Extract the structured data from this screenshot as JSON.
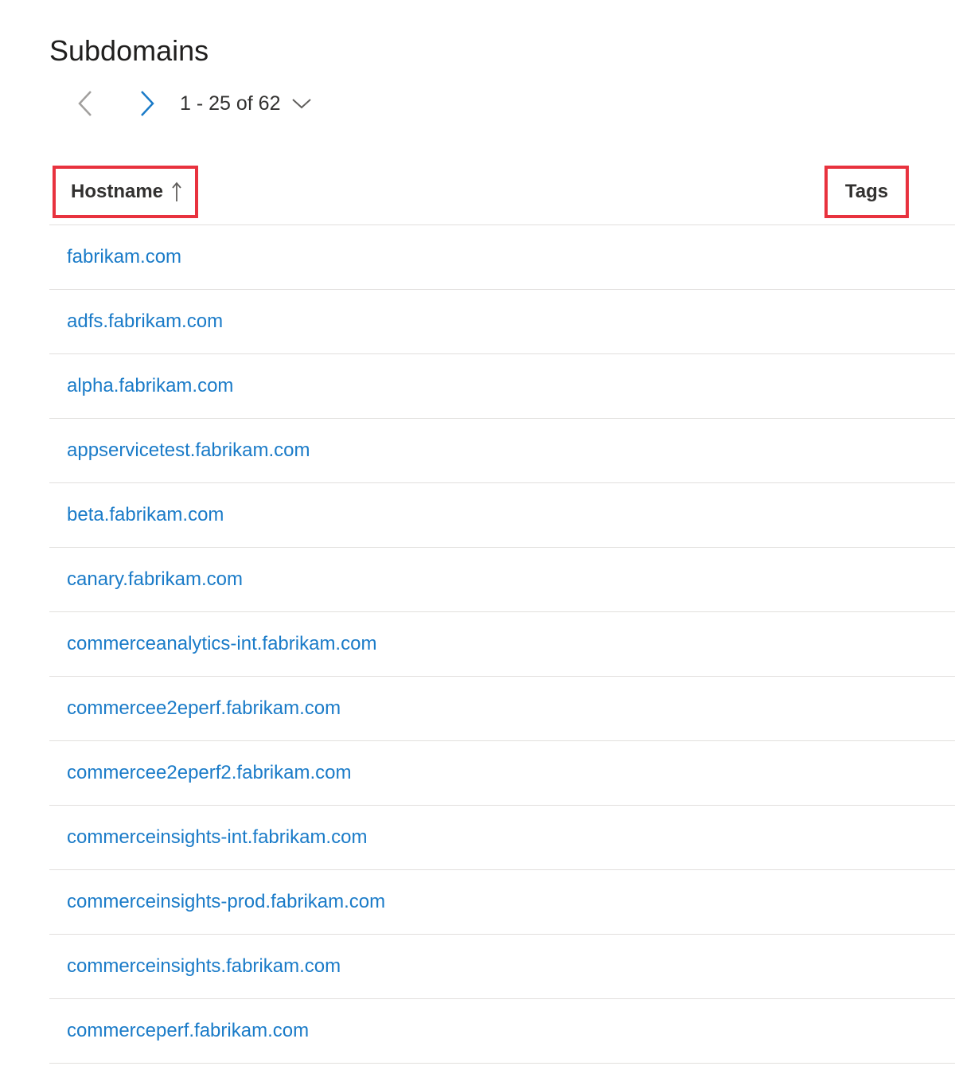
{
  "page": {
    "title": "Subdomains"
  },
  "pager": {
    "prev_icon": "chevron-left-icon",
    "next_icon": "chevron-right-icon",
    "range_label": "1 - 25 of 62",
    "dropdown_icon": "chevron-down-icon"
  },
  "table": {
    "columns": {
      "hostname": "Hostname",
      "tags": "Tags"
    },
    "sort": {
      "column": "Hostname",
      "direction": "ascending",
      "icon": "arrow-up-icon"
    },
    "rows": [
      "fabrikam.com",
      "adfs.fabrikam.com",
      "alpha.fabrikam.com",
      "appservicetest.fabrikam.com",
      "beta.fabrikam.com",
      "canary.fabrikam.com",
      "commerceanalytics-int.fabrikam.com",
      "commercee2eperf.fabrikam.com",
      "commercee2eperf2.fabrikam.com",
      "commerceinsights-int.fabrikam.com",
      "commerceinsights-prod.fabrikam.com",
      "commerceinsights.fabrikam.com",
      "commerceperf.fabrikam.com"
    ]
  },
  "colors": {
    "link": "#1a7bc8",
    "highlight_border": "#e8323e",
    "divider": "#e1dfdd",
    "text": "#201f1e"
  }
}
